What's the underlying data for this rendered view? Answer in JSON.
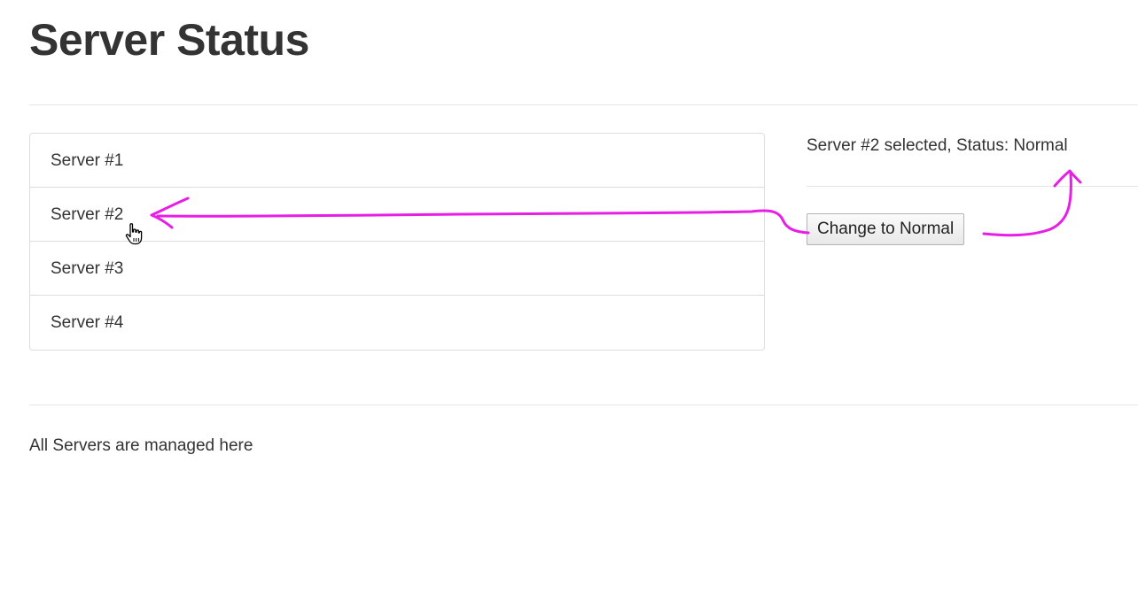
{
  "page": {
    "title": "Server Status",
    "footer": "All Servers are managed here"
  },
  "servers": [
    {
      "label": "Server #1"
    },
    {
      "label": "Server #2"
    },
    {
      "label": "Server #3"
    },
    {
      "label": "Server #4"
    }
  ],
  "detail": {
    "status_text": "Server #2 selected, Status: Normal",
    "change_button_label": "Change to Normal"
  },
  "annotation": {
    "color": "#e61ee6"
  },
  "icons": {
    "cursor": "hand-pointer-icon"
  }
}
